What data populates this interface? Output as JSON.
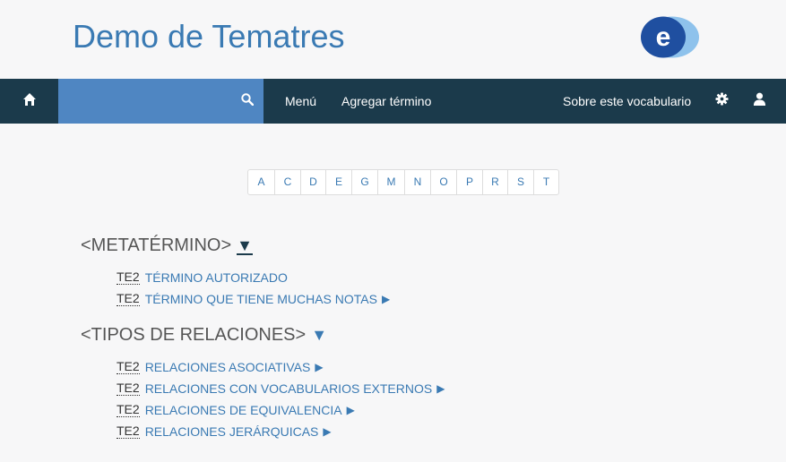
{
  "header": {
    "site_title": "Demo de Tematres",
    "logo_letter": "e"
  },
  "colors": {
    "navbar": "#1b3a4b",
    "search": "#4f86c2",
    "link": "#3a7ab3"
  },
  "navbar": {
    "search": {
      "value": "",
      "placeholder": ""
    },
    "menu_label": "Menú",
    "add_term_label": "Agregar término",
    "about_label": "Sobre este vocabulario"
  },
  "letters": [
    "A",
    "C",
    "D",
    "E",
    "G",
    "M",
    "N",
    "O",
    "P",
    "R",
    "S",
    "T"
  ],
  "groups": [
    {
      "title": "<METATÉRMINO>",
      "terms": [
        {
          "rel": "TE2",
          "label": "TÉRMINO AUTORIZADO",
          "has_children": false
        },
        {
          "rel": "TE2",
          "label": "TÉRMINO QUE TIENE MUCHAS NOTAS",
          "has_children": true
        }
      ]
    },
    {
      "title": "<TIPOS DE RELACIONES>",
      "terms": [
        {
          "rel": "TE2",
          "label": "RELACIONES ASOCIATIVAS",
          "has_children": true
        },
        {
          "rel": "TE2",
          "label": "RELACIONES CON VOCABULARIOS EXTERNOS",
          "has_children": true
        },
        {
          "rel": "TE2",
          "label": "RELACIONES DE EQUIVALENCIA",
          "has_children": true
        },
        {
          "rel": "TE2",
          "label": "RELACIONES JERÁRQUICAS",
          "has_children": true
        }
      ]
    }
  ]
}
